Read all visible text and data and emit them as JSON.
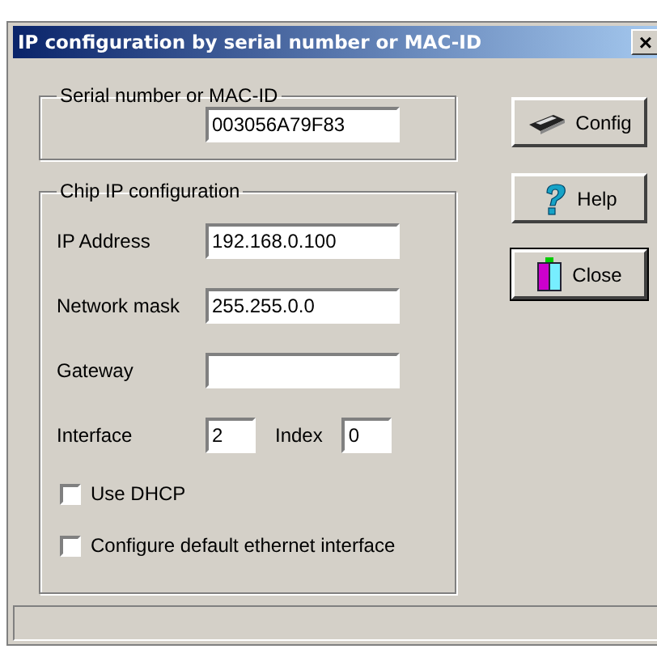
{
  "window": {
    "title": "IP configuration by serial number or MAC-ID",
    "close": "×"
  },
  "serial_group": {
    "legend": "Serial number or MAC-ID",
    "value": "003056A79F83"
  },
  "chip_group": {
    "legend": "Chip IP configuration",
    "fields": [
      {
        "label": "IP Address",
        "value": "192.168.0.100"
      },
      {
        "label": "Network mask",
        "value": "255.255.0.0"
      },
      {
        "label": "Gateway"
      }
    ],
    "interface": {
      "label": "Interface",
      "value": "2"
    },
    "index": {
      "label": "Index",
      "value": "0"
    },
    "checkboxes": [
      {
        "label": "Use DHCP",
        "checked": false
      },
      {
        "label": "Configure default ethernet interface",
        "checked": false
      }
    ]
  },
  "buttons": [
    {
      "kind": "config",
      "label": "Config",
      "focused": false
    },
    {
      "kind": "help",
      "label": "Help",
      "focused": false
    },
    {
      "kind": "close",
      "label": "Close",
      "focused": true
    }
  ]
}
